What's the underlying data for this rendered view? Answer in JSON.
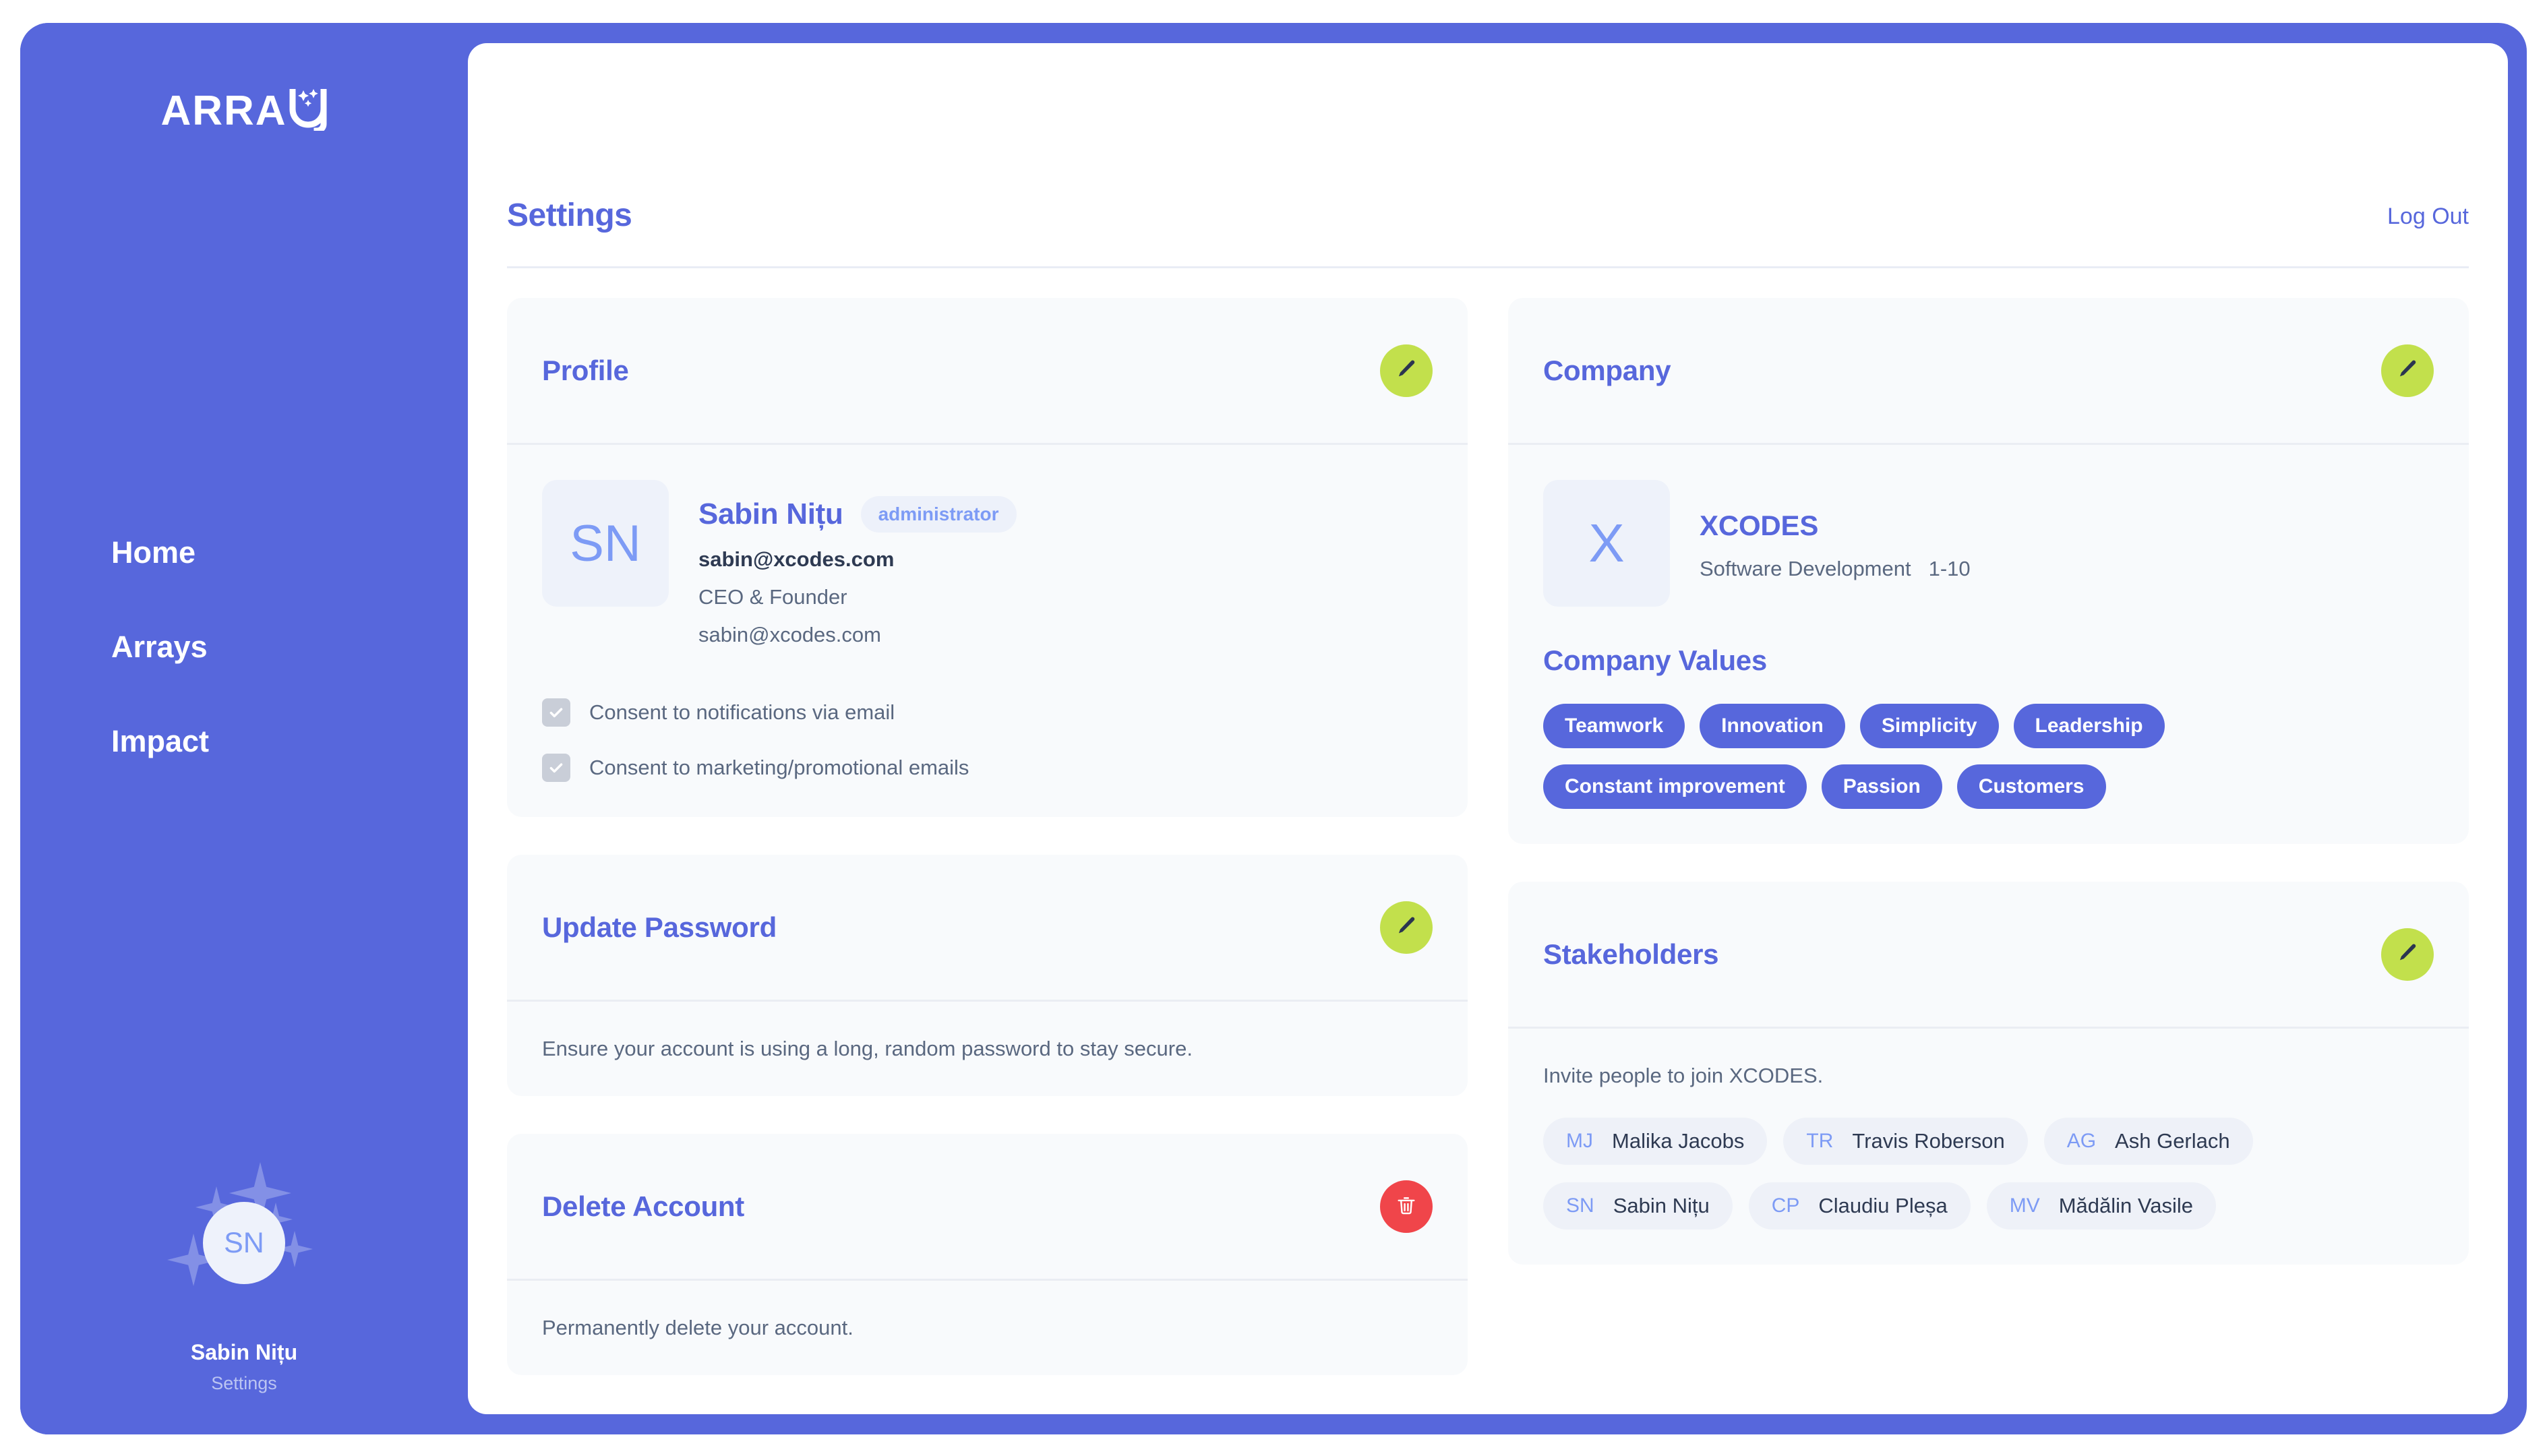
{
  "brand": {
    "logo_text": "ARRAY",
    "logo_main": "ARRA",
    "logo_y": "Y"
  },
  "sidebar": {
    "nav": [
      {
        "label": "Home"
      },
      {
        "label": "Arrays"
      },
      {
        "label": "Impact"
      }
    ],
    "user": {
      "initials": "SN",
      "name": "Sabin Nițu",
      "subtitle": "Settings"
    }
  },
  "header": {
    "title": "Settings",
    "logout_label": "Log Out"
  },
  "profile": {
    "card_title": "Profile",
    "edit_icon": "pencil-icon",
    "avatar_initials": "SN",
    "name": "Sabin Nițu",
    "role_badge": "administrator",
    "email_bold": "sabin@xcodes.com",
    "job_title": "CEO & Founder",
    "email_secondary": "sabin@xcodes.com",
    "consents": [
      {
        "label": "Consent to notifications via email",
        "checked": true
      },
      {
        "label": "Consent to marketing/promotional emails",
        "checked": true
      }
    ]
  },
  "update_password": {
    "card_title": "Update Password",
    "edit_icon": "pencil-icon",
    "description": "Ensure your account is using a long, random password to stay secure."
  },
  "delete_account": {
    "card_title": "Delete Account",
    "delete_icon": "trash-icon",
    "description": "Permanently delete your account."
  },
  "company": {
    "card_title": "Company",
    "edit_icon": "pencil-icon",
    "logo_letter": "X",
    "name": "XCODES",
    "industry": "Software Development",
    "size": "1-10",
    "values_title": "Company Values",
    "values": [
      "Teamwork",
      "Innovation",
      "Simplicity",
      "Leadership",
      "Constant improvement",
      "Passion",
      "Customers"
    ]
  },
  "stakeholders": {
    "card_title": "Stakeholders",
    "edit_icon": "pencil-icon",
    "invite_text": "Invite people to join XCODES.",
    "people": [
      {
        "initials": "MJ",
        "name": "Malika Jacobs"
      },
      {
        "initials": "TR",
        "name": "Travis Roberson"
      },
      {
        "initials": "AG",
        "name": "Ash Gerlach"
      },
      {
        "initials": "SN",
        "name": "Sabin Nițu"
      },
      {
        "initials": "CP",
        "name": "Claudiu Pleșa"
      },
      {
        "initials": "MV",
        "name": "Mădălin Vasile"
      }
    ]
  },
  "colors": {
    "brand_purple": "#5767DC",
    "accent_lime": "#C2E04C",
    "danger_red": "#F0454A",
    "card_bg": "#F8FAFC",
    "periwinkle": "#7D9BF5"
  }
}
